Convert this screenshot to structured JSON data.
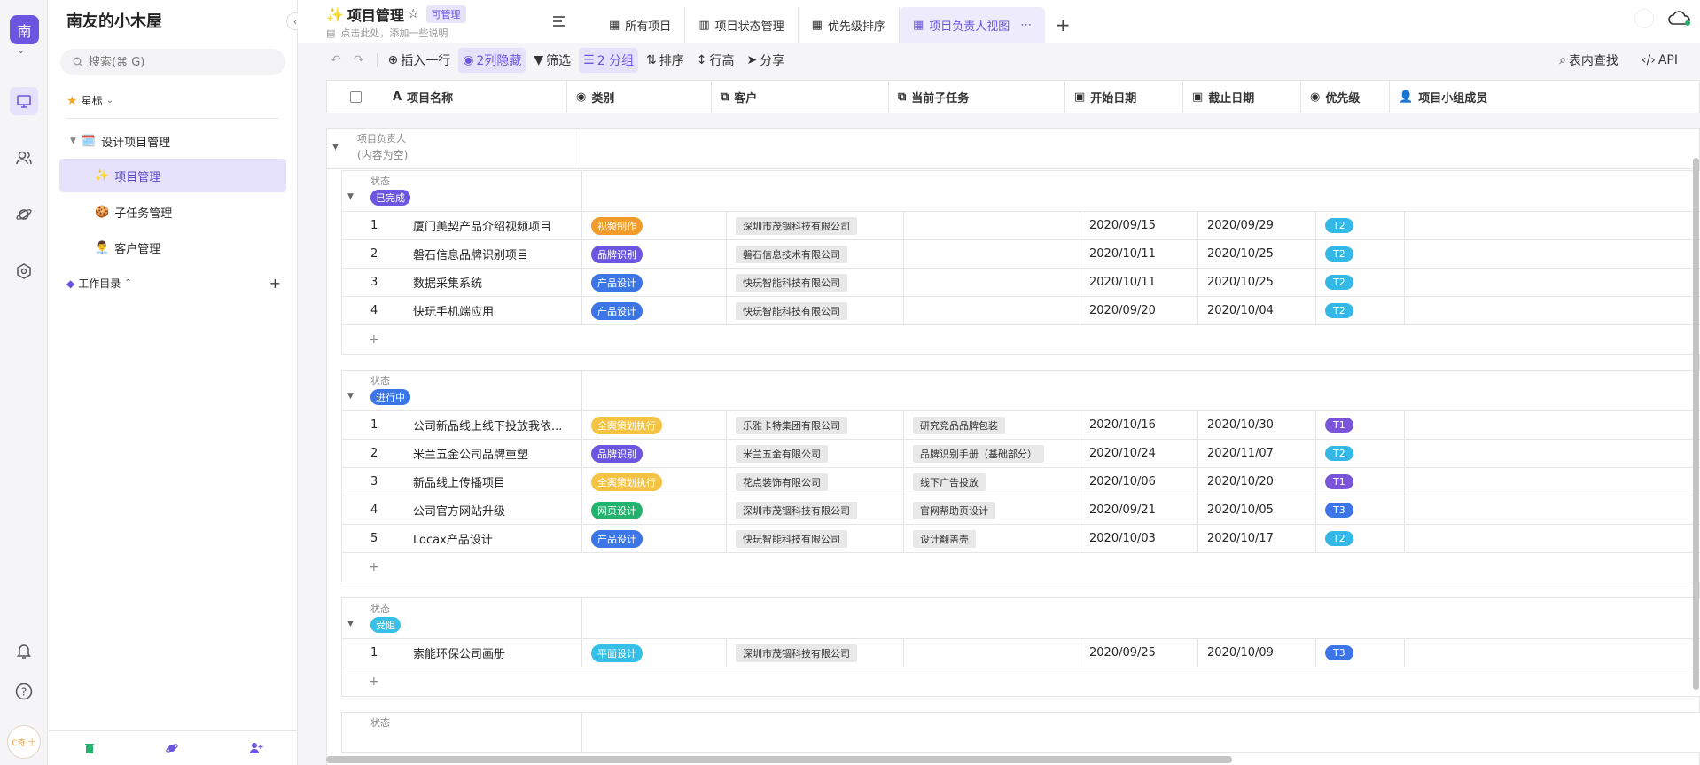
{
  "rail": {
    "workspace_initial": "南",
    "avatar_text": "C奇·士"
  },
  "sidebar": {
    "title": "南友的小木屋",
    "search_placeholder": "搜索(⌘ G)",
    "starred_label": "星标",
    "tree": [
      {
        "label": "设计项目管理",
        "icon": "🗓️"
      },
      {
        "label": "项目管理",
        "icon": "✨"
      },
      {
        "label": "子任务管理",
        "icon": "🍪"
      },
      {
        "label": "客户管理",
        "icon": "👨‍💼"
      }
    ],
    "workdir_label": "工作目录"
  },
  "header": {
    "icon": "✨",
    "title": "项目管理",
    "badge": "可管理",
    "description": "点击此处，添加一些说明",
    "tabs": [
      "所有项目",
      "项目状态管理",
      "优先级排序",
      "项目负责人视图"
    ],
    "active_tab": "项目负责人视图"
  },
  "toolbar": {
    "insert_row": "插入一行",
    "hidden_cols": "2列隐藏",
    "filter": "筛选",
    "group": "2 分组",
    "sort": "排序",
    "row_height": "行高",
    "share": "分享",
    "find": "表内查找",
    "api": "API"
  },
  "columns": [
    "项目名称",
    "类别",
    "客户",
    "当前子任务",
    "开始日期",
    "截止日期",
    "优先级",
    "项目小组成员"
  ],
  "group": {
    "caption": "项目负责人",
    "value": "(内容为空)"
  },
  "status_caption": "状态",
  "status_groups": [
    {
      "status": "已完成",
      "color": "#6c55e0",
      "rows": [
        {
          "n": "1",
          "name": "厦门美契产品介绍视频项目",
          "cat": "视频制作",
          "cat_color": "#f29c2c",
          "cust": "深圳市茂锢科技有限公司",
          "sub": "",
          "sd": "2020/09/15",
          "ed": "2020/09/29",
          "pri": "T2",
          "pri_color": "#34b8e6"
        },
        {
          "n": "2",
          "name": "磐石信息品牌识别项目",
          "cat": "品牌识别",
          "cat_color": "#6c55e0",
          "cust": "磐石信息技术有限公司",
          "sub": "",
          "sd": "2020/10/11",
          "ed": "2020/10/25",
          "pri": "T2",
          "pri_color": "#34b8e6"
        },
        {
          "n": "3",
          "name": "数据采集系统",
          "cat": "产品设计",
          "cat_color": "#3c75e6",
          "cust": "快玩智能科技有限公司",
          "sub": "",
          "sd": "2020/10/11",
          "ed": "2020/10/25",
          "pri": "T2",
          "pri_color": "#34b8e6"
        },
        {
          "n": "4",
          "name": "快玩手机端应用",
          "cat": "产品设计",
          "cat_color": "#3c75e6",
          "cust": "快玩智能科技有限公司",
          "sub": "",
          "sd": "2020/09/20",
          "ed": "2020/10/04",
          "pri": "T2",
          "pri_color": "#34b8e6"
        }
      ]
    },
    {
      "status": "进行中",
      "color": "#3c75e6",
      "rows": [
        {
          "n": "1",
          "name": "公司新品线上线下投放我依...",
          "cat": "全案策划执行",
          "cat_color": "#f5c344",
          "cust": "乐雅卡特集团有限公司",
          "sub": "研究竞品品牌包装",
          "sd": "2020/10/16",
          "ed": "2020/10/30",
          "pri": "T1",
          "pri_color": "#7a55d8"
        },
        {
          "n": "2",
          "name": "米兰五金公司品牌重塑",
          "cat": "品牌识别",
          "cat_color": "#6c55e0",
          "cust": "米兰五金有限公司",
          "sub": "品牌识别手册（基础部分）",
          "sd": "2020/10/24",
          "ed": "2020/11/07",
          "pri": "T2",
          "pri_color": "#34b8e6"
        },
        {
          "n": "3",
          "name": "新品线上传播项目",
          "cat": "全案策划执行",
          "cat_color": "#f5c344",
          "cust": "花点装饰有限公司",
          "sub": "线下广告投放",
          "sd": "2020/10/06",
          "ed": "2020/10/20",
          "pri": "T1",
          "pri_color": "#7a55d8"
        },
        {
          "n": "4",
          "name": "公司官方网站升级",
          "cat": "网页设计",
          "cat_color": "#23b26d",
          "cust": "深圳市茂锢科技有限公司",
          "sub": "官网帮助页设计",
          "sd": "2020/09/21",
          "ed": "2020/10/05",
          "pri": "T3",
          "pri_color": "#3c75e6"
        },
        {
          "n": "5",
          "name": "Locax产品设计",
          "cat": "产品设计",
          "cat_color": "#3c75e6",
          "cust": "快玩智能科技有限公司",
          "sub": "设计翻盖壳",
          "sd": "2020/10/03",
          "ed": "2020/10/17",
          "pri": "T2",
          "pri_color": "#34b8e6"
        }
      ]
    },
    {
      "status": "受阻",
      "color": "#36c0e8",
      "rows": [
        {
          "n": "1",
          "name": "索能环保公司画册",
          "cat": "平面设计",
          "cat_color": "#36c0e8",
          "cust": "深圳市茂锢科技有限公司",
          "sub": "",
          "sd": "2020/09/25",
          "ed": "2020/10/09",
          "pri": "T3",
          "pri_color": "#3c75e6"
        }
      ]
    }
  ]
}
